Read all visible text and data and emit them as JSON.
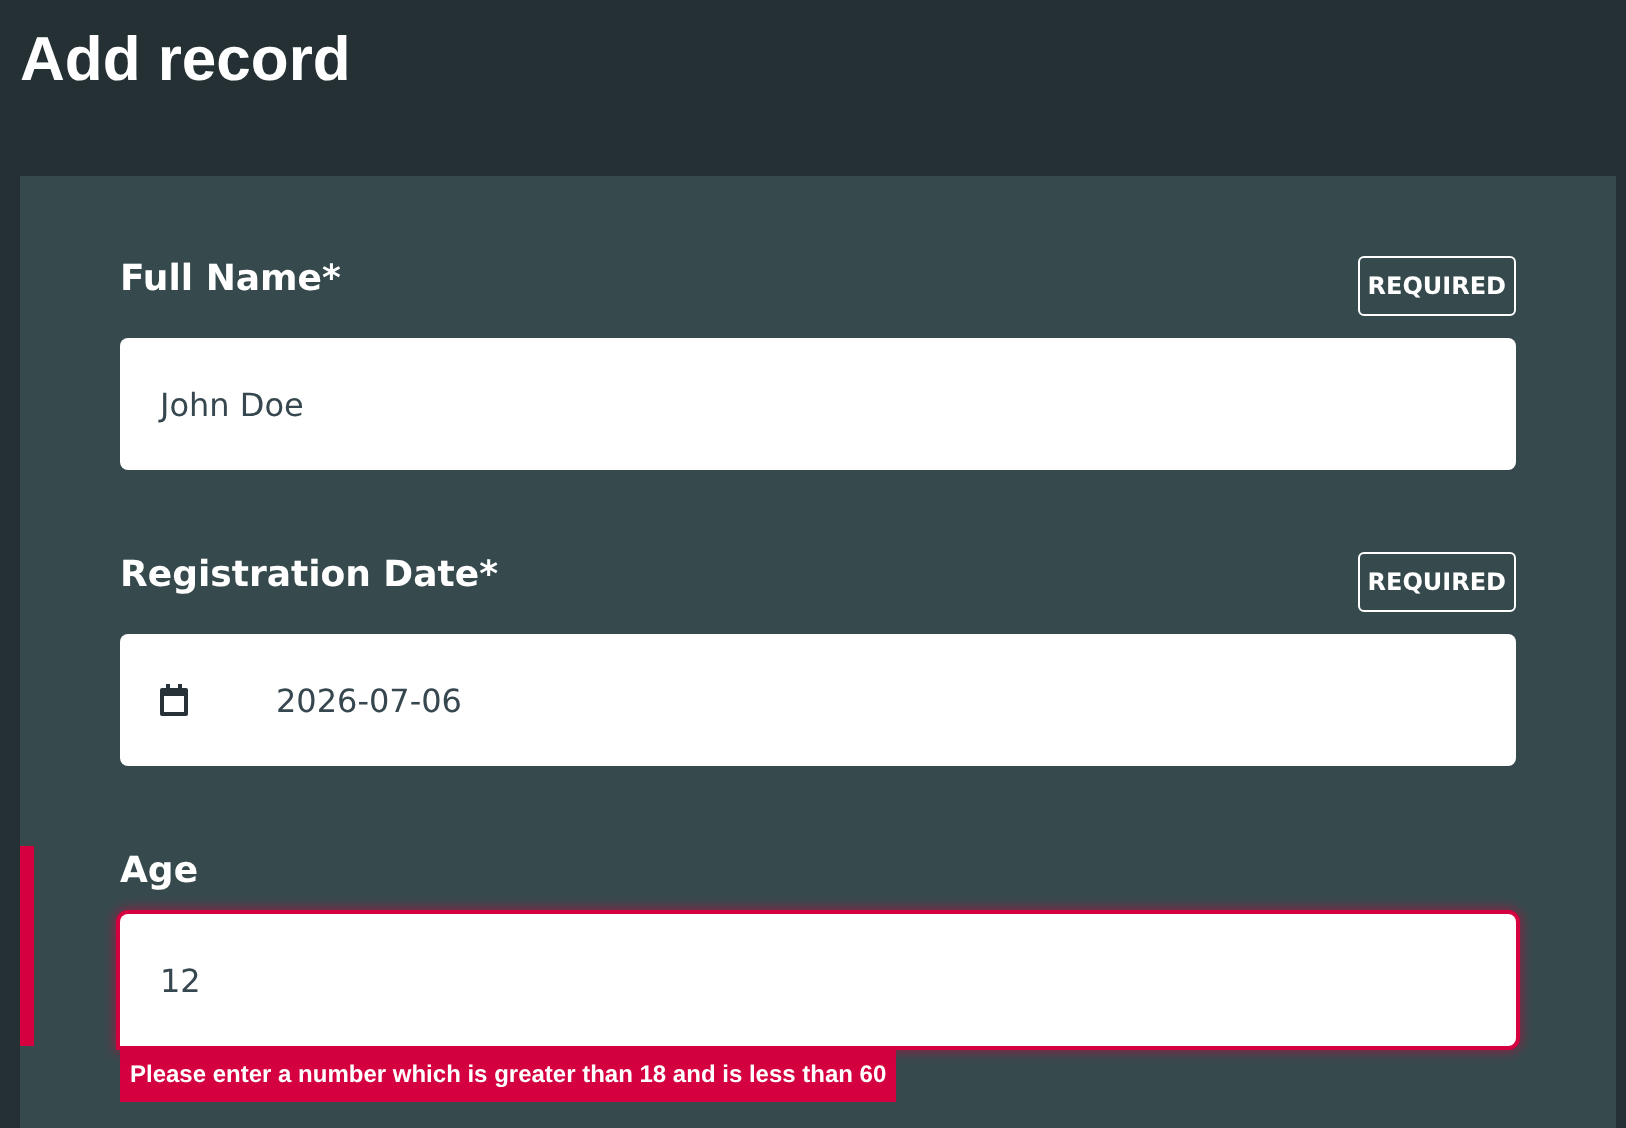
{
  "page": {
    "title": "Add record"
  },
  "fields": [
    {
      "kind": "text",
      "label": "Full Name*",
      "badge": "REQUIRED",
      "value": "John Doe",
      "invalid": false
    },
    {
      "kind": "date",
      "label": "Registration Date*",
      "badge": "REQUIRED",
      "value": "2026-07-06",
      "invalid": false
    },
    {
      "kind": "text",
      "label": "Age",
      "value": "12",
      "invalid": true,
      "error": "Please enter a number which is greater than 18 and is less than 60"
    }
  ]
}
